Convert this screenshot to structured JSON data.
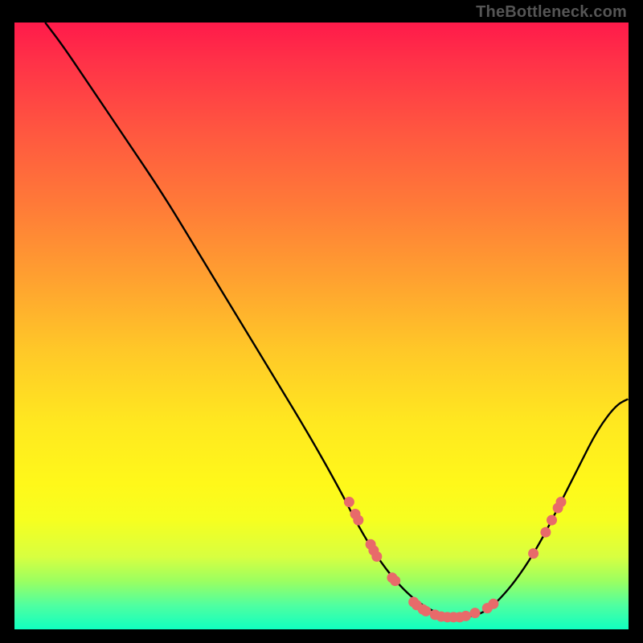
{
  "attribution": "TheBottleneck.com",
  "chart_data": {
    "type": "line",
    "title": "",
    "xlabel": "",
    "ylabel": "",
    "xlim": [
      0,
      100
    ],
    "ylim": [
      0,
      100
    ],
    "grid": false,
    "legend": false,
    "curve": {
      "name": "bottleneck-curve",
      "color": "#000000",
      "x": [
        5,
        8,
        12,
        18,
        24,
        30,
        36,
        42,
        48,
        53,
        56,
        59,
        62,
        65,
        68,
        71,
        74,
        77,
        80,
        83,
        86,
        89,
        92,
        95,
        98,
        100
      ],
      "y": [
        100,
        96,
        90,
        81,
        72,
        62,
        52,
        42,
        32,
        23,
        17,
        12,
        8,
        5,
        3,
        2,
        2,
        3,
        6,
        10,
        15,
        21,
        27,
        33,
        37,
        38
      ]
    },
    "markers": {
      "name": "highlighted-points",
      "color": "#e86a6a",
      "points": [
        {
          "x": 54.5,
          "y": 21
        },
        {
          "x": 55.5,
          "y": 19
        },
        {
          "x": 56.0,
          "y": 18
        },
        {
          "x": 58.0,
          "y": 14
        },
        {
          "x": 58.5,
          "y": 13
        },
        {
          "x": 59.0,
          "y": 12
        },
        {
          "x": 61.5,
          "y": 8.5
        },
        {
          "x": 62.0,
          "y": 8
        },
        {
          "x": 65.0,
          "y": 4.5
        },
        {
          "x": 65.5,
          "y": 4
        },
        {
          "x": 66.5,
          "y": 3.3
        },
        {
          "x": 67.0,
          "y": 3
        },
        {
          "x": 68.5,
          "y": 2.4
        },
        {
          "x": 69.5,
          "y": 2.1
        },
        {
          "x": 70.5,
          "y": 2
        },
        {
          "x": 71.5,
          "y": 2
        },
        {
          "x": 72.5,
          "y": 2
        },
        {
          "x": 73.5,
          "y": 2.2
        },
        {
          "x": 75.0,
          "y": 2.7
        },
        {
          "x": 77.0,
          "y": 3.5
        },
        {
          "x": 78.0,
          "y": 4.2
        },
        {
          "x": 84.5,
          "y": 12.5
        },
        {
          "x": 86.5,
          "y": 16
        },
        {
          "x": 87.5,
          "y": 18
        },
        {
          "x": 88.5,
          "y": 20
        },
        {
          "x": 89.0,
          "y": 21
        }
      ]
    }
  }
}
